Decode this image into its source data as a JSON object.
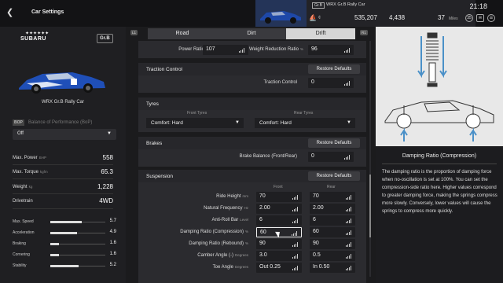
{
  "header": {
    "title": "Car Settings",
    "car_badge": "Gr.B",
    "car_name": "WRX Gr.B Rally Car",
    "credits": "535,207",
    "mileage": "4,438",
    "miles_value": "37",
    "miles_unit": "Miles",
    "clock": "21:18",
    "level": "35"
  },
  "car_panel": {
    "brand": "SUBARU",
    "brand_stars": "✦✦✦✦✦✦",
    "group": "Gr.B",
    "car_label": "WRX Gr.B Rally Car",
    "bop_tag": "BOP",
    "bop_label": "Balance of Performance (BoP)",
    "bop_value": "Off",
    "specs": [
      {
        "label": "Max. Power",
        "unit": "BHP",
        "value": "558"
      },
      {
        "label": "Max. Torque",
        "unit": "kgfm",
        "value": "65.3"
      },
      {
        "label": "Weight",
        "unit": "kg",
        "value": "1,228"
      },
      {
        "label": "Drivetrain",
        "unit": "",
        "value": "4WD"
      }
    ],
    "performance": [
      {
        "label": "Max. Speed",
        "value": "5.7",
        "level": 0.57
      },
      {
        "label": "Acceleration",
        "value": "4.9",
        "level": 0.49
      },
      {
        "label": "Braking",
        "value": "1.6",
        "level": 0.16
      },
      {
        "label": "Cornering",
        "value": "1.6",
        "level": 0.16
      },
      {
        "label": "Stability",
        "value": "5.2",
        "level": 0.52
      }
    ]
  },
  "tabs": {
    "left_key": "L1",
    "right_key": "R1",
    "items": [
      "Road",
      "Dirt",
      "Drift"
    ],
    "active": "Drift"
  },
  "settings": {
    "restore": "Restore Defaults",
    "power_ratio_label": "Power Ratio",
    "power_ratio_unit": "%",
    "power_ratio_value": "107",
    "weight_reduction_label": "Weight Reduction Ratio",
    "weight_reduction_unit": "%",
    "weight_reduction_value": "96",
    "traction": {
      "title": "Traction Control",
      "field": "Traction Control",
      "value": "0"
    },
    "tyres": {
      "title": "Tyres",
      "front_head": "Front Tyres",
      "rear_head": "Rear Tyres",
      "front": "Comfort: Hard",
      "rear": "Comfort: Hard"
    },
    "brakes": {
      "title": "Brakes",
      "field": "Brake Balance (Front/Rear)",
      "value": "0"
    },
    "suspension": {
      "title": "Suspension",
      "front_head": "Front",
      "rear_head": "Rear",
      "rows": [
        {
          "label": "Ride Height",
          "unit": "mm",
          "front": "70",
          "rear": "70"
        },
        {
          "label": "Natural Frequency",
          "unit": "Hz",
          "front": "2.00",
          "rear": "2.00"
        },
        {
          "label": "Anti-Roll Bar",
          "unit": "Level",
          "front": "6",
          "rear": "6"
        },
        {
          "label": "Damping Ratio (Compression)",
          "unit": "%",
          "front": "60",
          "rear": "60"
        },
        {
          "label": "Damping Ratio (Rebound)",
          "unit": "%",
          "front": "90",
          "rear": "90"
        },
        {
          "label": "Camber Angle (-)",
          "unit": "Degrees",
          "front": "3.0",
          "rear": "0.5"
        },
        {
          "label": "Toe Angle",
          "unit": "Degrees",
          "front": "Out 0.25",
          "rear": "In 0.50"
        }
      ]
    }
  },
  "help": {
    "title": "Damping Ratio (Compression)",
    "text": "The damping ratio is the proportion of damping force when no-oscillation is set at 100%. You can set the compression-side ratio here. Higher values correspond to greater damping force, making the springs compress more slowly. Conversely, lower values will cause the springs to compress more quickly."
  },
  "colors": {
    "accent": "#d6d6d6",
    "panel": "#2b2b2f",
    "diagram_arrow": "#4a90c8"
  }
}
